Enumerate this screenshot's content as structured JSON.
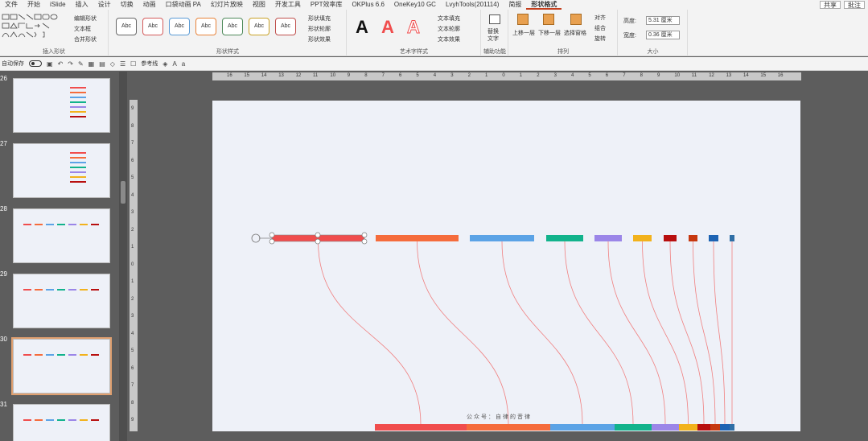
{
  "menu": {
    "tabs": [
      "文件",
      "开始",
      "iSlide",
      "插入",
      "设计",
      "切换",
      "动画",
      "口袋动画 PA",
      "幻灯片放映",
      "视图",
      "开发工具",
      "PPT效率库",
      "OKPlus 6.6",
      "OneKey10 GC",
      "LvyhTools(201114)",
      "简报",
      "形状格式"
    ],
    "active": "形状格式",
    "share": "共享",
    "comments": "批注"
  },
  "ribbon": {
    "insert_shape": {
      "label": "插入形状",
      "edit_shape": "编辑形状",
      "textbox": "文本框",
      "merge_shapes": "合并形状"
    },
    "shape_styles": {
      "label": "形状样式",
      "sample": "Abc",
      "fill": "形状填充",
      "outline": "形状轮廓",
      "effects": "形状效果"
    },
    "wordart": {
      "label": "艺术字样式",
      "letter": "A",
      "text_fill": "文本填充",
      "text_outline": "文本轮廓",
      "text_effects": "文本效果"
    },
    "accessibility": {
      "label": "辅助功能",
      "alt_text_1": "替换",
      "alt_text_2": "文字"
    },
    "arrange": {
      "label": "排列",
      "bring_forward": "上移一层",
      "send_backward": "下移一层",
      "selection_pane": "选择窗格",
      "align": "对齐",
      "group": "组合",
      "rotate": "旋转"
    },
    "size": {
      "label": "大小",
      "height_label": "高度:",
      "height_value": "5.31 厘米",
      "width_label": "宽度:",
      "width_value": "0.36 厘米"
    }
  },
  "qat": {
    "autosave": "自动保存",
    "reference_line": "参考线"
  },
  "thumbnails": [
    {
      "num": "26"
    },
    {
      "num": "27"
    },
    {
      "num": "28"
    },
    {
      "num": "29"
    },
    {
      "num": "30",
      "selected": true
    },
    {
      "num": "31"
    }
  ],
  "ruler": {
    "h_ticks": [
      "16",
      "15",
      "14",
      "13",
      "12",
      "11",
      "10",
      "9",
      "8",
      "7",
      "6",
      "5",
      "4",
      "3",
      "2",
      "1",
      "0",
      "1",
      "2",
      "3",
      "4",
      "5",
      "6",
      "7",
      "8",
      "9",
      "10",
      "11",
      "12",
      "13",
      "14",
      "15",
      "16"
    ],
    "v_ticks": [
      "9",
      "8",
      "7",
      "6",
      "5",
      "4",
      "3",
      "2",
      "1",
      "0",
      "1",
      "2",
      "3",
      "4",
      "5",
      "6",
      "7",
      "8",
      "9"
    ]
  },
  "slide": {
    "footer": "公众号：自律的音律",
    "colors": {
      "red": "#f04d4d",
      "orange": "#f56c3c",
      "blue": "#5ba3e6",
      "teal": "#12b38c",
      "purple": "#9b86e8",
      "yellow": "#f2b21c",
      "darkred": "#b80f0f",
      "rust": "#c6380f",
      "navy": "#1d63b3",
      "steel": "#2f6fa6",
      "link": "#f08080"
    }
  }
}
